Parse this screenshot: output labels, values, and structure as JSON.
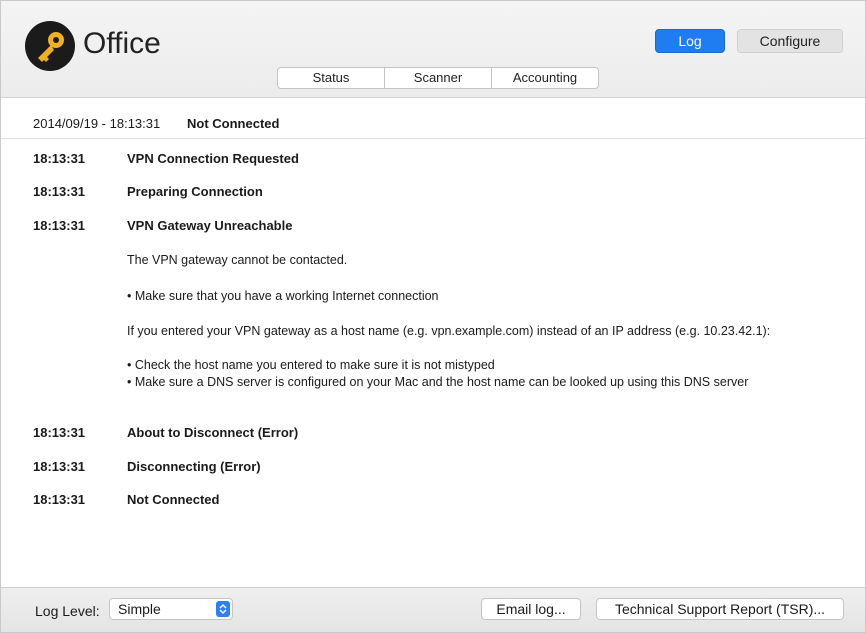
{
  "app": {
    "title": "Office"
  },
  "header": {
    "log_label": "Log",
    "configure_label": "Configure",
    "tabs": [
      "Status",
      "Scanner",
      "Accounting"
    ]
  },
  "status": {
    "datetime": "2014/09/19 - 18:13:31",
    "state": "Not Connected"
  },
  "log": {
    "entries": [
      {
        "time": "18:13:31",
        "message": "VPN Connection Requested"
      },
      {
        "time": "18:13:31",
        "message": "Preparing Connection"
      },
      {
        "time": "18:13:31",
        "message": "VPN Gateway Unreachable"
      },
      {
        "time": "18:13:31",
        "message": "About to Disconnect (Error)"
      },
      {
        "time": "18:13:31",
        "message": "Disconnecting (Error)"
      },
      {
        "time": "18:13:31",
        "message": "Not Connected"
      }
    ],
    "details": {
      "line1": "The VPN gateway cannot be contacted.",
      "line2": "• Make sure that you have a working Internet connection",
      "line3": "If you entered your VPN gateway as a host name (e.g. vpn.example.com) instead of an IP address (e.g. 10.23.42.1):",
      "line4": "• Check the host name you entered to make sure it is not mistyped",
      "line5": "• Make sure a DNS server is configured on your Mac and the host name can be looked up using this DNS server"
    }
  },
  "footer": {
    "log_level_label": "Log Level:",
    "log_level_value": "Simple",
    "email_label": "Email log...",
    "tsr_label": "Technical Support Report (TSR)..."
  },
  "colors": {
    "accent": "#1f7cf1",
    "header_bg": "#f0f0f0"
  },
  "icons": {
    "app": "key-icon",
    "select": "updown-chevron-icon"
  }
}
